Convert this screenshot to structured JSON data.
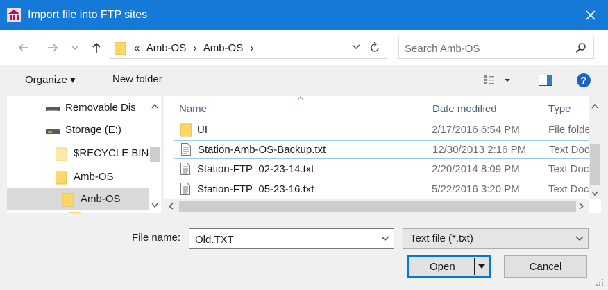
{
  "window": {
    "title": "Import file into FTP sites",
    "titlebar_color": "#1479d7"
  },
  "address": {
    "prefix": "«",
    "crumbs": [
      "Amb-OS",
      "Amb-OS"
    ],
    "separator": "›",
    "search_placeholder": "Search Amb-OS"
  },
  "toolbar": {
    "organize_label": "Organize ▾",
    "new_folder_label": "New folder"
  },
  "nav_tree": [
    {
      "label": "Removable Dis",
      "icon": "drive-icon"
    },
    {
      "label": "Storage (E:)",
      "icon": "storage-drive-icon"
    },
    {
      "label": "$RECYCLE.BIN",
      "icon": "folder-icon"
    },
    {
      "label": "Amb-OS",
      "icon": "folder-icon"
    },
    {
      "label": "Amb-OS",
      "icon": "folder-icon",
      "selected": true
    }
  ],
  "columns": {
    "name": "Name",
    "date": "Date modified",
    "type": "Type"
  },
  "files": [
    {
      "name": "UI",
      "date": "2/17/2016 6:54 PM",
      "type": "File folder",
      "icon": "folder-icon"
    },
    {
      "name": "Station-Amb-OS-Backup.txt",
      "date": "12/30/2013 2:16 PM",
      "type": "Text Document",
      "icon": "text-file-icon",
      "focused": true
    },
    {
      "name": "Station-FTP_02-23-14.txt",
      "date": "2/20/2014 8:09 PM",
      "type": "Text Document",
      "icon": "text-file-icon"
    },
    {
      "name": "Station-FTP_05-23-16.txt",
      "date": "5/22/2016 3:20 PM",
      "type": "Text Document",
      "icon": "text-file-icon"
    }
  ],
  "bottom": {
    "file_name_label": "File name:",
    "file_name_value": "Old.TXT",
    "file_type_value": "Text file (*.txt)",
    "open_label": "Open",
    "cancel_label": "Cancel"
  },
  "colors": {
    "accent": "#0078d7",
    "help": "#1a64c8",
    "folder": "#ffd766"
  }
}
